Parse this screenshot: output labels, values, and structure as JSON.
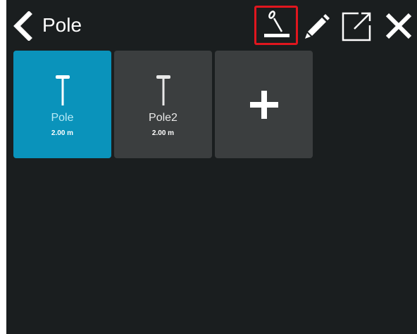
{
  "header": {
    "title": "Pole",
    "back_icon": "chevron-left-icon",
    "tools": [
      {
        "name": "pole-tool",
        "icon": "pole-tool-icon",
        "highlighted": true,
        "highlight_color": "#e0161e"
      },
      {
        "name": "edit",
        "icon": "pencil-icon"
      },
      {
        "name": "export",
        "icon": "external-link-icon"
      },
      {
        "name": "close",
        "icon": "close-icon"
      }
    ]
  },
  "tiles": [
    {
      "name": "Pole",
      "length": "2.00 m",
      "selected": true,
      "icon": "pole-icon"
    },
    {
      "name": "Pole2",
      "length": "2.00 m",
      "selected": false,
      "icon": "pole-icon"
    }
  ],
  "add_tile": {
    "icon": "plus-icon"
  },
  "colors": {
    "background": "#1a1e1f",
    "selected_tile": "#0a93bb",
    "tile": "#3b3e3f"
  }
}
